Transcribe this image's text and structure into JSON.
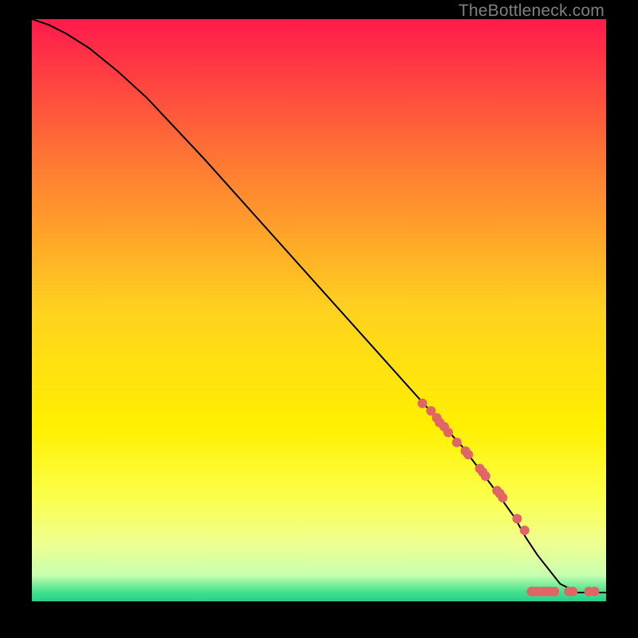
{
  "watermark": "TheBottleneck.com",
  "chart_data": {
    "type": "line",
    "title": "",
    "xlabel": "",
    "ylabel": "",
    "xlim": [
      0,
      100
    ],
    "ylim": [
      0,
      100
    ],
    "grid": false,
    "legend": false,
    "background_gradient": {
      "stops": [
        {
          "offset": 0.0,
          "color": "#ff1a4b"
        },
        {
          "offset": 0.25,
          "color": "#ff7a33"
        },
        {
          "offset": 0.5,
          "color": "#ffd21f"
        },
        {
          "offset": 0.7,
          "color": "#fff000"
        },
        {
          "offset": 0.82,
          "color": "#fbff4a"
        },
        {
          "offset": 0.9,
          "color": "#f0ff90"
        },
        {
          "offset": 0.955,
          "color": "#c8ffb0"
        },
        {
          "offset": 0.985,
          "color": "#3fe08c"
        },
        {
          "offset": 1.0,
          "color": "#2bcf8c"
        }
      ]
    },
    "series": [
      {
        "name": "curve",
        "type": "line",
        "color": "#000000",
        "x": [
          0,
          3,
          6,
          10,
          15,
          20,
          30,
          40,
          50,
          60,
          70,
          75,
          80,
          84,
          86,
          88,
          90,
          92,
          95,
          100
        ],
        "y": [
          100,
          99,
          97.5,
          95,
          91,
          86.5,
          76,
          65,
          54,
          43,
          32,
          26.5,
          20,
          14.5,
          11,
          8,
          5.5,
          3,
          1.5,
          1.5
        ]
      },
      {
        "name": "points",
        "type": "scatter",
        "color": "#e06666",
        "radius": 6,
        "x": [
          68,
          69.5,
          70.5,
          71,
          71.8,
          72.5,
          74,
          75.5,
          76,
          78,
          78.5,
          79,
          81,
          81.5,
          82,
          84.5,
          85.8,
          87,
          87.5,
          88.2,
          89,
          89.7,
          90.3,
          91,
          93.5,
          94.2,
          97,
          98
        ],
        "y": [
          34,
          32.7,
          31.5,
          30.7,
          30,
          29,
          27.3,
          25.8,
          25.2,
          22.8,
          22.2,
          21.5,
          19,
          18.5,
          17.8,
          14.2,
          12.2,
          1.7,
          1.7,
          1.7,
          1.7,
          1.7,
          1.7,
          1.7,
          1.7,
          1.7,
          1.7,
          1.7
        ]
      }
    ]
  }
}
